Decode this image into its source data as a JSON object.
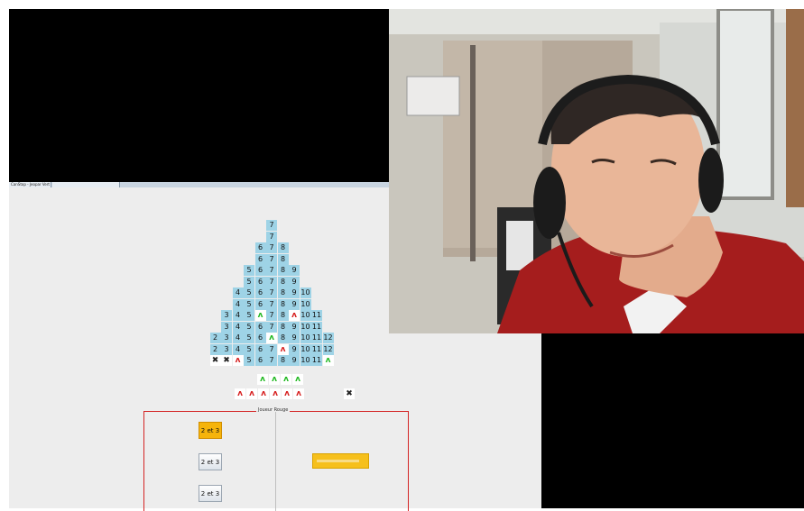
{
  "taskbar": {
    "tabs": [
      "CanStop - Jeopar Vert",
      ""
    ]
  },
  "board": {
    "rows": [
      [
        "7"
      ],
      [
        "7"
      ],
      [
        "6",
        "7",
        "8"
      ],
      [
        "6",
        "7",
        "8"
      ],
      [
        "5",
        "6",
        "7",
        "8",
        "9"
      ],
      [
        "5",
        "6",
        "7",
        "8",
        "9"
      ],
      [
        "4",
        "5",
        "6",
        "7",
        "8",
        "9",
        "10"
      ],
      [
        "4",
        "5",
        "6",
        "7",
        "8",
        "9",
        "10"
      ],
      [
        "3",
        "4",
        "5",
        "^g",
        "7",
        "8",
        "^r",
        "10",
        "11"
      ],
      [
        "3",
        "4",
        "5",
        "6",
        "7",
        "8",
        "9",
        "10",
        "11"
      ],
      [
        "2",
        "3",
        "4",
        "5",
        "6",
        "^g",
        "8",
        "9",
        "10",
        "11",
        "12"
      ],
      [
        "2",
        "3",
        "4",
        "5",
        "6",
        "7",
        "^r",
        "9",
        "10",
        "11",
        "12"
      ],
      [
        "*",
        "*",
        "^r",
        "5",
        "6",
        "7",
        "8",
        "9",
        "10",
        "11",
        "^g"
      ]
    ]
  },
  "markers": {
    "green_row": [
      "^g",
      "^g",
      "^g",
      "^g"
    ],
    "red_row": [
      "^r",
      "^r",
      "^r",
      "^r",
      "^r",
      "^r"
    ],
    "pawn_right": "*"
  },
  "player_panel": {
    "legend": "Joueur Rouge",
    "dice_choices": [
      {
        "label": "2 et 3",
        "active": true
      },
      {
        "label": "2 et 3",
        "active": false
      },
      {
        "label": "2 et 3",
        "active": false
      }
    ],
    "progress": 0.85
  },
  "colors": {
    "board_cell": "#9ed3e6",
    "green_marker": "#1fb81f",
    "red_marker": "#d61c1c",
    "active_button": "#f6b40c",
    "panel_border": "#d42424"
  }
}
